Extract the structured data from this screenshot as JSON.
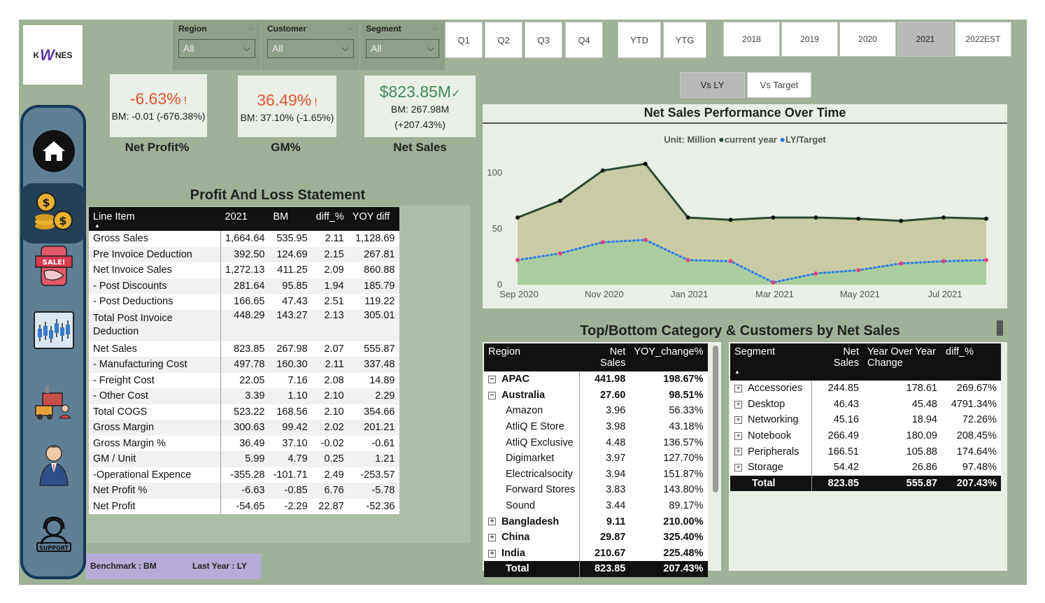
{
  "logo": {
    "text_left": "K",
    "text_mid": "W",
    "text_right": "NES"
  },
  "filters": [
    {
      "label": "Region",
      "value": "All"
    },
    {
      "label": "Customer",
      "value": "All"
    },
    {
      "label": "Segment",
      "value": "All"
    }
  ],
  "quarters": [
    "Q1",
    "Q2",
    "Q3",
    "Q4"
  ],
  "periods": [
    "YTD",
    "YTG"
  ],
  "years": [
    "2018",
    "2019",
    "2020",
    "2021",
    "2022EST"
  ],
  "selected_year": "2021",
  "compare": {
    "vs_ly": "Vs LY",
    "vs_target": "Vs Target"
  },
  "kpis": [
    {
      "value": "-6.63%",
      "flag": "!",
      "bm": "BM: -0.01 (-676.38%)",
      "bm2": "",
      "title": "Net Profit%",
      "color": "#e2562f"
    },
    {
      "value": "36.49%",
      "flag": "!",
      "bm": "BM: 37.10% (-1.65%)",
      "bm2": "",
      "title": "GM%",
      "color": "#e2562f"
    },
    {
      "value": "$823.85M",
      "flag": "✓",
      "bm": "BM: 267.98M",
      "bm2": "(+207.43%)",
      "title": "Net Sales",
      "color": "#3f8a5a"
    }
  ],
  "pl": {
    "title": "Profit And Loss Statement",
    "headers": [
      "Line Item",
      "2021",
      "BM",
      "diff_%",
      "YOY diff"
    ],
    "rows": [
      [
        "Gross Sales",
        "1,664.64",
        "535.95",
        "2.11",
        "1,128.69"
      ],
      [
        "Pre Invoice Deduction",
        "392.50",
        "124.69",
        "2.15",
        "267.81"
      ],
      [
        "Net Invoice Sales",
        "1,272.13",
        "411.25",
        "2.09",
        "860.88"
      ],
      [
        "- Post Discounts",
        "281.64",
        "95.85",
        "1.94",
        "185.79"
      ],
      [
        "- Post Deductions",
        "166.65",
        "47.43",
        "2.51",
        "119.22"
      ],
      [
        "Total Post Invoice Deduction",
        "448.29",
        "143.27",
        "2.13",
        "305.01"
      ],
      [
        "Net Sales",
        "823.85",
        "267.98",
        "2.07",
        "555.87"
      ],
      [
        "- Manufacturing Cost",
        "497.78",
        "160.30",
        "2.11",
        "337.48"
      ],
      [
        "- Freight Cost",
        "22.05",
        "7.16",
        "2.08",
        "14.89"
      ],
      [
        "- Other Cost",
        "3.39",
        "1.10",
        "2.10",
        "2.29"
      ],
      [
        "Total COGS",
        "523.22",
        "168.56",
        "2.10",
        "354.66"
      ],
      [
        "Gross Margin",
        "300.63",
        "99.42",
        "2.02",
        "201.21"
      ],
      [
        "Gross Margin %",
        "36.49",
        "37.10",
        "-0.02",
        "-0.61"
      ],
      [
        "GM / Unit",
        "5.99",
        "4.79",
        "0.25",
        "1.21"
      ],
      [
        "-Operational Expence",
        "-355.28",
        "-101.71",
        "2.49",
        "-253.57"
      ],
      [
        "Net Profit %",
        "-6.63",
        "-0.85",
        "6.76",
        "-5.78"
      ],
      [
        "Net Profit",
        "-54.65",
        "-2.29",
        "22.87",
        "-52.36"
      ]
    ]
  },
  "footer": {
    "benchmark": "Benchmark : BM",
    "last_year": "Last Year : LY"
  },
  "chart_data": {
    "type": "area",
    "title": "Net Sales Performance Over Time",
    "unit_label": "Unit: Million",
    "series": [
      {
        "name": "current year",
        "color": "#2d4a32",
        "values": [
          60,
          75,
          102,
          108,
          60,
          58,
          60,
          60,
          59,
          57,
          60,
          59
        ]
      },
      {
        "name": "LY/Target",
        "color": "#2e7de9",
        "values": [
          22,
          28,
          38,
          40,
          22,
          21,
          2,
          10,
          13,
          19,
          21,
          22
        ]
      }
    ],
    "x": [
      "2020-09",
      "2020-10",
      "2020-11",
      "2020-12",
      "2021-01",
      "2021-02",
      "2021-03",
      "2021-04",
      "2021-05",
      "2021-06",
      "2021-07",
      "2021-08"
    ],
    "xticks": [
      "Sep 2020",
      "Nov 2020",
      "Jan 2021",
      "Mar 2021",
      "May 2021",
      "Jul 2021"
    ],
    "yticks": [
      "0",
      "50",
      "100"
    ],
    "ylim": [
      0,
      110
    ]
  },
  "topbottom": {
    "title": "Top/Bottom Category & Customers by Net Sales"
  },
  "region_table": {
    "headers": [
      "Region",
      "Net Sales",
      "YOY_change%"
    ],
    "rows": [
      {
        "exp": "⊟",
        "name": "APAC",
        "sales": "441.98",
        "chg": "198.67%",
        "bold": true
      },
      {
        "exp": "⊟",
        "name": "Australia",
        "sales": "27.60",
        "chg": "98.51%",
        "bold": true
      },
      {
        "exp": "",
        "name": "Amazon",
        "sales": "3.96",
        "chg": "56.33%",
        "bold": false
      },
      {
        "exp": "",
        "name": "AtliQ E Store",
        "sales": "3.98",
        "chg": "43.18%",
        "bold": false
      },
      {
        "exp": "",
        "name": "AtliQ Exclusive",
        "sales": "4.48",
        "chg": "136.57%",
        "bold": false
      },
      {
        "exp": "",
        "name": "Digimarket",
        "sales": "3.97",
        "chg": "127.70%",
        "bold": false
      },
      {
        "exp": "",
        "name": "Electricalsocity",
        "sales": "3.94",
        "chg": "151.87%",
        "bold": false
      },
      {
        "exp": "",
        "name": "Forward Stores",
        "sales": "3.83",
        "chg": "143.80%",
        "bold": false
      },
      {
        "exp": "",
        "name": "Sound",
        "sales": "3.44",
        "chg": "89.17%",
        "bold": false
      },
      {
        "exp": "⊞",
        "name": "Bangladesh",
        "sales": "9.11",
        "chg": "210.00%",
        "bold": true
      },
      {
        "exp": "⊞",
        "name": "China",
        "sales": "29.87",
        "chg": "325.40%",
        "bold": true
      },
      {
        "exp": "⊞",
        "name": "India",
        "sales": "210.67",
        "chg": "225.48%",
        "bold": true
      }
    ],
    "total": {
      "name": "Total",
      "sales": "823.85",
      "chg": "207.43%"
    }
  },
  "segment_table": {
    "headers": [
      "Segment",
      "Net Sales",
      "Year Over Year Change",
      "diff_%"
    ],
    "rows": [
      {
        "name": "Accessories",
        "sales": "244.85",
        "yoy": "178.61",
        "diff": "269.67%"
      },
      {
        "name": "Desktop",
        "sales": "46.43",
        "yoy": "45.48",
        "diff": "4791.34%"
      },
      {
        "name": "Networking",
        "sales": "45.16",
        "yoy": "18.94",
        "diff": "72.26%"
      },
      {
        "name": "Notebook",
        "sales": "266.49",
        "yoy": "180.09",
        "diff": "208.45%"
      },
      {
        "name": "Peripherals",
        "sales": "166.51",
        "yoy": "105.88",
        "diff": "174.64%"
      },
      {
        "name": "Storage",
        "sales": "54.42",
        "yoy": "26.86",
        "diff": "97.48%"
      }
    ],
    "total": {
      "name": "Total",
      "sales": "823.85",
      "yoy": "555.87",
      "diff": "207.43%"
    }
  },
  "nav_icons": [
    "home-icon",
    "finance-icon",
    "sales-icon",
    "market-chart-icon",
    "supply-chain-icon",
    "executive-icon",
    "support-icon"
  ]
}
